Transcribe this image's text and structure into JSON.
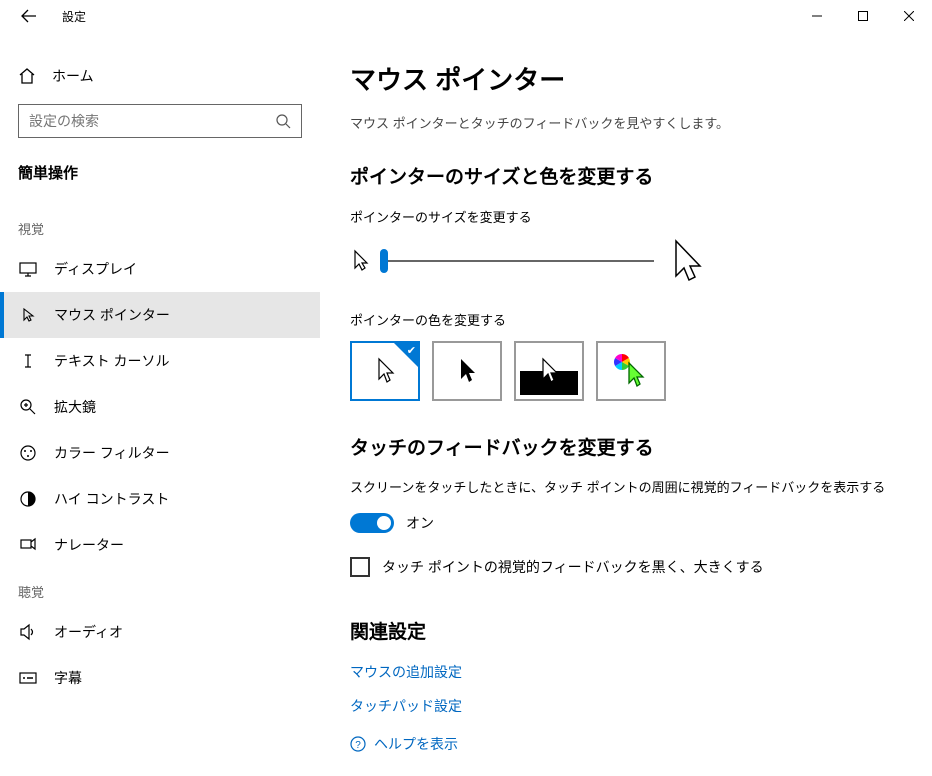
{
  "window": {
    "title": "設定",
    "minimize": "minimize",
    "maximize": "maximize",
    "close": "close"
  },
  "sidebar": {
    "home": "ホーム",
    "search_placeholder": "設定の検索",
    "category": "簡単操作",
    "group_vision": "視覚",
    "group_hearing": "聴覚",
    "items": {
      "display": "ディスプレイ",
      "mouse_pointer": "マウス ポインター",
      "text_cursor": "テキスト カーソル",
      "magnifier": "拡大鏡",
      "color_filters": "カラー フィルター",
      "high_contrast": "ハイ コントラスト",
      "narrator": "ナレーター",
      "audio": "オーディオ",
      "captions": "字幕"
    }
  },
  "main": {
    "title": "マウス ポインター",
    "desc": "マウス ポインターとタッチのフィードバックを見やすくします。",
    "size_color_heading": "ポインターのサイズと色を変更する",
    "size_label": "ポインターのサイズを変更する",
    "color_label": "ポインターの色を変更する",
    "touch_heading": "タッチのフィードバックを変更する",
    "touch_desc": "スクリーンをタッチしたときに、タッチ ポイントの周囲に視覚的フィードバックを表示する",
    "toggle_on": "オン",
    "touch_dark_big": "タッチ ポイントの視覚的フィードバックを黒く、大きくする",
    "related_heading": "関連設定",
    "link_mouse": "マウスの追加設定",
    "link_touchpad": "タッチパッド設定",
    "help": "ヘルプを表示"
  },
  "state": {
    "pointer_size_slider": 1,
    "pointer_size_min": 1,
    "pointer_size_max": 15,
    "pointer_color_selected": "white",
    "touch_feedback_enabled": true,
    "touch_feedback_dark_large": false
  },
  "colors": {
    "accent": "#0078d4",
    "link": "#0067c0"
  }
}
